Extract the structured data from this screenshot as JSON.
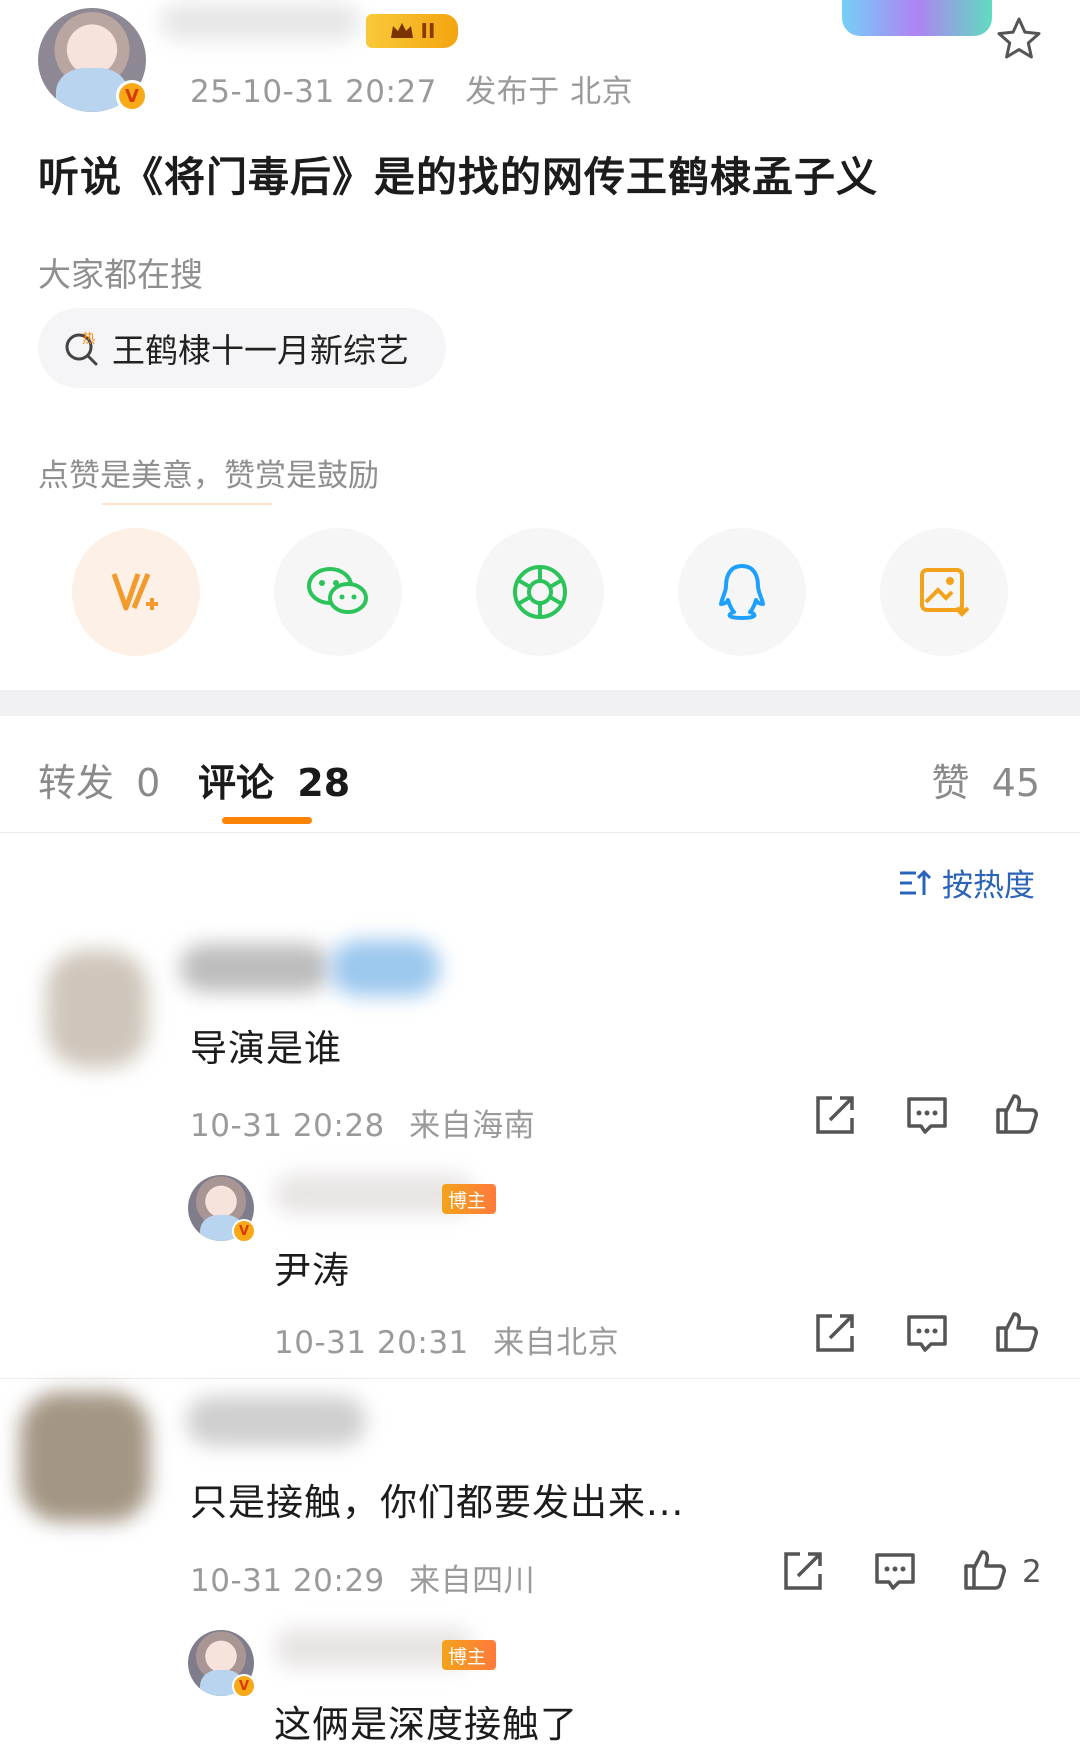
{
  "post": {
    "timestamp": "25-10-31 20:27",
    "location": "发布于 北京",
    "text": "听说《将门毒后》是的找的网传王鹤棣孟子义"
  },
  "search": {
    "section_label": "大家都在搜",
    "hot_icon_text": "热",
    "topic": "王鹤棣十一月新综艺"
  },
  "reward": {
    "label": "点赞是美意，赞赏是鼓励",
    "share_icons": [
      "reward-v-icon",
      "wechat-icon",
      "moments-icon",
      "qq-icon",
      "save-image-icon"
    ]
  },
  "tabs": {
    "repost_label": "转发",
    "repost_count": "0",
    "comment_label": "评论",
    "comment_count": "28",
    "like_label": "赞",
    "like_count": "45"
  },
  "sort": {
    "label": "按热度"
  },
  "comments": [
    {
      "text": "导演是谁",
      "time": "10-31 20:28",
      "location": "来自海南",
      "likes": "",
      "reply": {
        "badge": "博主",
        "text": "尹涛",
        "time": "10-31 20:31",
        "location": "来自北京"
      }
    },
    {
      "text": "只是接触，你们都要发出来...",
      "time": "10-31 20:29",
      "location": "来自四川",
      "likes": "2",
      "reply": {
        "badge": "博主",
        "text": "这俩是深度接触了"
      }
    }
  ],
  "colors": {
    "accent": "#ff8200",
    "link": "#2a64b8",
    "meta": "#9a9a9a",
    "badge": "#f8a917"
  }
}
